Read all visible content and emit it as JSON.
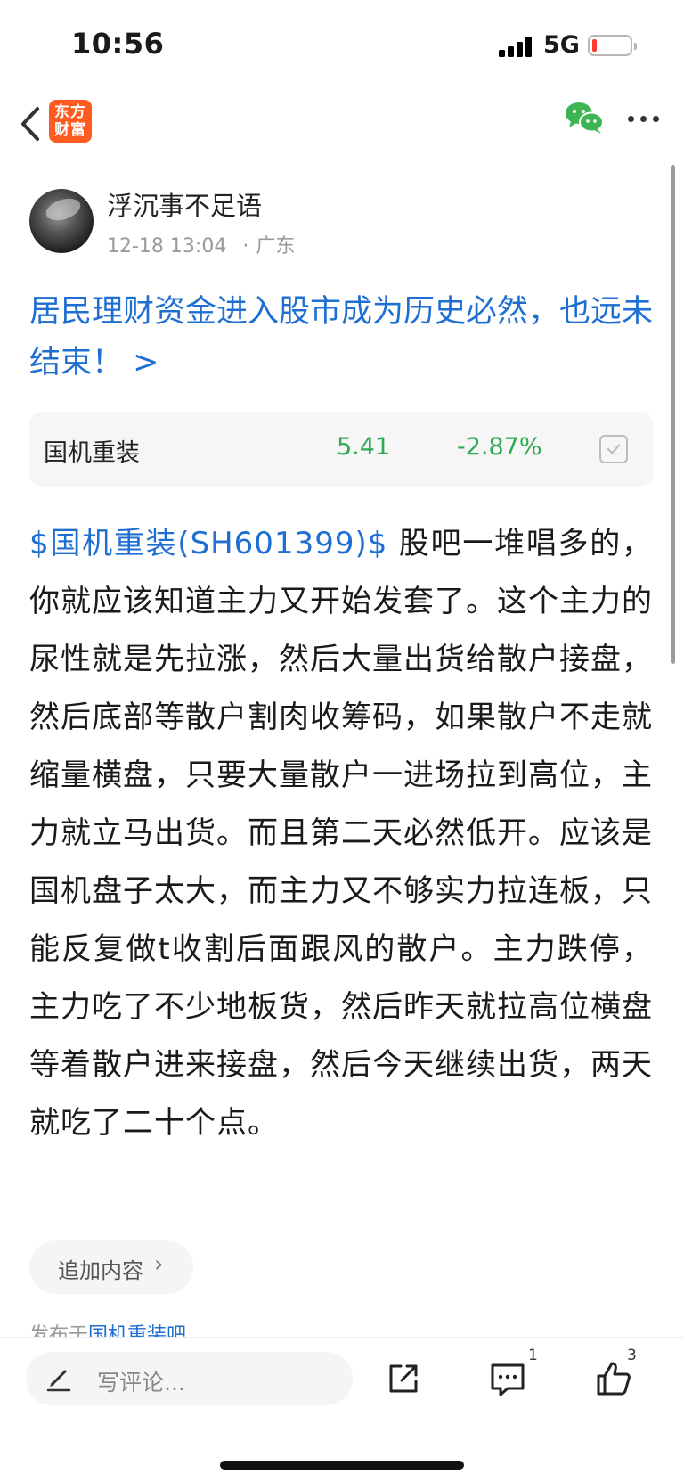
{
  "status_bar": {
    "time": "10:56",
    "network": "5G",
    "battery_level": 0.12,
    "battery_color": "#ff3b30"
  },
  "nav": {
    "back_icon": "chevron-left-icon",
    "logo_text": "东方财富",
    "logo_color": "#ff5a1f",
    "wechat_icon": "wechat-icon",
    "more_icon": "more-icon"
  },
  "author": {
    "name": "浮沉事不足语",
    "time": "12-18 13:04",
    "separator": "·",
    "location": "广东"
  },
  "post": {
    "title": "居民理财资金进入股市成为历史必然，也远未结束！ >",
    "title_color": "#1f6fd2",
    "stock": {
      "name": "国机重装",
      "price": "5.41",
      "change": "-2.87%",
      "color": "#30a954"
    },
    "body_tag": "$国机重装(SH601399)$",
    "body_text": "  股吧一堆唱多的，你就应该知道主力又开始发套了。这个主力的尿性就是先拉涨，然后大量出货给散户接盘，然后底部等散户割肉收筹码，如果散户不走就缩量横盘，只要大量散户一进场拉到高位，主力就立马出货。而且第二天必然低开。应该是国机盘子太大，而主力又不够实力拉连板，只能反复做t收割后面跟风的散户。主力跌停，主力吃了不少地板货，然后昨天就拉高位横盘等着散户进来接盘，然后今天继续出货，两天就吃了二十个点。",
    "append_label": "追加内容",
    "posted_prefix": "发布于",
    "posted_bar": "国机重装吧"
  },
  "bottom_bar": {
    "comment_placeholder": "写评论...",
    "comment_count": "1",
    "like_count": "3"
  }
}
